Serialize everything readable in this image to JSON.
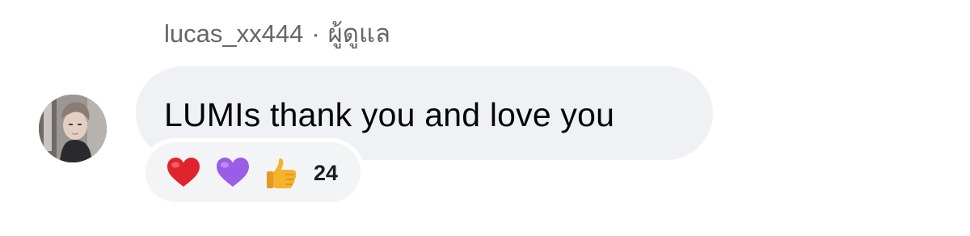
{
  "comment": {
    "author": "lucas_xx444",
    "separator": "·",
    "role": "ผู้ดูแล",
    "text": "LUMIs thank you and love you",
    "avatar_icon": "user-avatar-photo"
  },
  "reactions": {
    "icons": [
      "red-heart-emoji",
      "purple-heart-emoji",
      "thumbs-up-emoji"
    ],
    "count": "24"
  },
  "colors": {
    "bubble": "#eff1f4",
    "meta_text": "#65676b",
    "text": "#050505",
    "red_heart": "#e0242d",
    "purple_heart": "#9b5de5",
    "thumbs_up": "#f5b32b"
  }
}
